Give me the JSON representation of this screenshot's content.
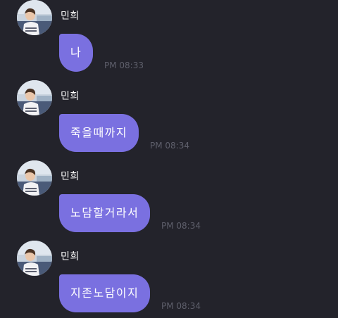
{
  "chat": {
    "messages": [
      {
        "sender": "민희",
        "text": "나",
        "time": "PM 08:33"
      },
      {
        "sender": "민희",
        "text": "죽을때까지",
        "time": "PM 08:34"
      },
      {
        "sender": "민희",
        "text": "노담할거라서",
        "time": "PM 08:34"
      },
      {
        "sender": "민희",
        "text": "지존노담이지",
        "time": "PM 08:34"
      }
    ]
  },
  "colors": {
    "background": "#23232b",
    "bubble": "#7a70e0",
    "bubble_text": "#ffffff",
    "sender_text": "#ffffff",
    "timestamp": "#5e5f6b"
  },
  "icons": {
    "avatar": "profile-photo"
  }
}
